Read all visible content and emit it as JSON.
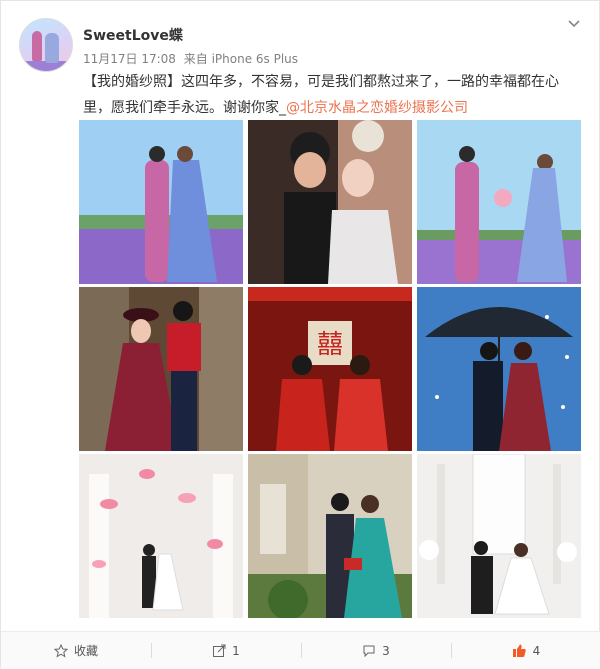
{
  "user": {
    "name": "SweetLove蝶"
  },
  "meta": {
    "time": "11月17日 17:08",
    "source": "来自 iPhone 6s Plus"
  },
  "post": {
    "text": "【我的婚纱照】这四年多，不容易，可是我们都熬过来了，一路的幸福都在心里，愿我们牵手永远。谢谢你家_",
    "mention": "@北京水晶之恋婚纱摄影公司"
  },
  "photos": [
    {
      "alt": "couple in lavender field"
    },
    {
      "alt": "couple close-up with bride tiara"
    },
    {
      "alt": "couple with bouquet in flower field"
    },
    {
      "alt": "couple in burgundy gown indoor"
    },
    {
      "alt": "traditional red chinese wedding"
    },
    {
      "alt": "couple under umbrella with snow"
    },
    {
      "alt": "white hall with pink petals"
    },
    {
      "alt": "couple with statue garden"
    },
    {
      "alt": "white church interior couple"
    }
  ],
  "actions": {
    "favorite": "收藏",
    "repost": "1",
    "comment": "3",
    "like": "4"
  },
  "colors": {
    "link": "#eb7350",
    "like": "#f15b2a"
  }
}
